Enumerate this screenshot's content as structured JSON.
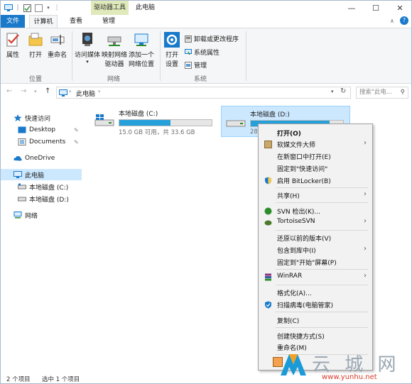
{
  "window": {
    "context_tab": "驱动器工具",
    "title": "此电脑"
  },
  "tabs": [
    {
      "label": "文件"
    },
    {
      "label": "计算机"
    },
    {
      "label": "查看"
    },
    {
      "label": "管理"
    }
  ],
  "ribbon": {
    "location": {
      "items": [
        "属性",
        "打开",
        "重命名"
      ],
      "group": "位置"
    },
    "network": {
      "items": [
        "访问媒体",
        "映射网络",
        "驱动器",
        "添加一个",
        "网络位置"
      ],
      "group": "网络"
    },
    "system": {
      "open_settings": [
        "打开",
        "设置"
      ],
      "small": [
        "卸载或更改程序",
        "系统属性",
        "管理"
      ],
      "group": "系统"
    }
  },
  "address": {
    "path": "此电脑",
    "search_placeholder": "搜索\"此电..."
  },
  "nav": {
    "items": [
      {
        "label": "快速访问"
      },
      {
        "label": "Desktop"
      },
      {
        "label": "Documents"
      },
      {
        "label": "OneDrive"
      },
      {
        "label": "此电脑"
      },
      {
        "label": "本地磁盘 (C:)"
      },
      {
        "label": "本地磁盘 (D:)"
      },
      {
        "label": "网络"
      }
    ]
  },
  "drives": [
    {
      "name": "本地磁盘 (C:)",
      "info": "15.0 GB 可用，共 33.6 GB",
      "used_fraction": 0.55
    },
    {
      "name": "本地磁盘 (D:)",
      "info": "28.",
      "used_fraction": 0.85
    }
  ],
  "menu": {
    "items": [
      "打开(O)",
      "软媒文件大师",
      "在新窗口中打开(E)",
      "固定到\"快速访问\"",
      "启用 BitLocker(B)",
      "共享(H)",
      "SVN 检出(K)...",
      "TortoiseSVN",
      "还原以前的版本(V)",
      "包含到库中(I)",
      "固定到\"开始\"屏幕(P)",
      "WinRAR",
      "格式化(A)...",
      "扫描病毒(电脑管家)",
      "复制(C)",
      "创建快捷方式(S)",
      "重命名(M)"
    ]
  },
  "status": {
    "count": "2 个项目",
    "selected": "选中 1 个项目"
  },
  "watermark": {
    "brand": "云 城 网",
    "url": "www.yunhu.net"
  },
  "colors": {
    "accent": "#1979ca",
    "selection": "#cce8ff",
    "drive_bar": "#26a0da",
    "context_tab": "#dfe9b9"
  }
}
